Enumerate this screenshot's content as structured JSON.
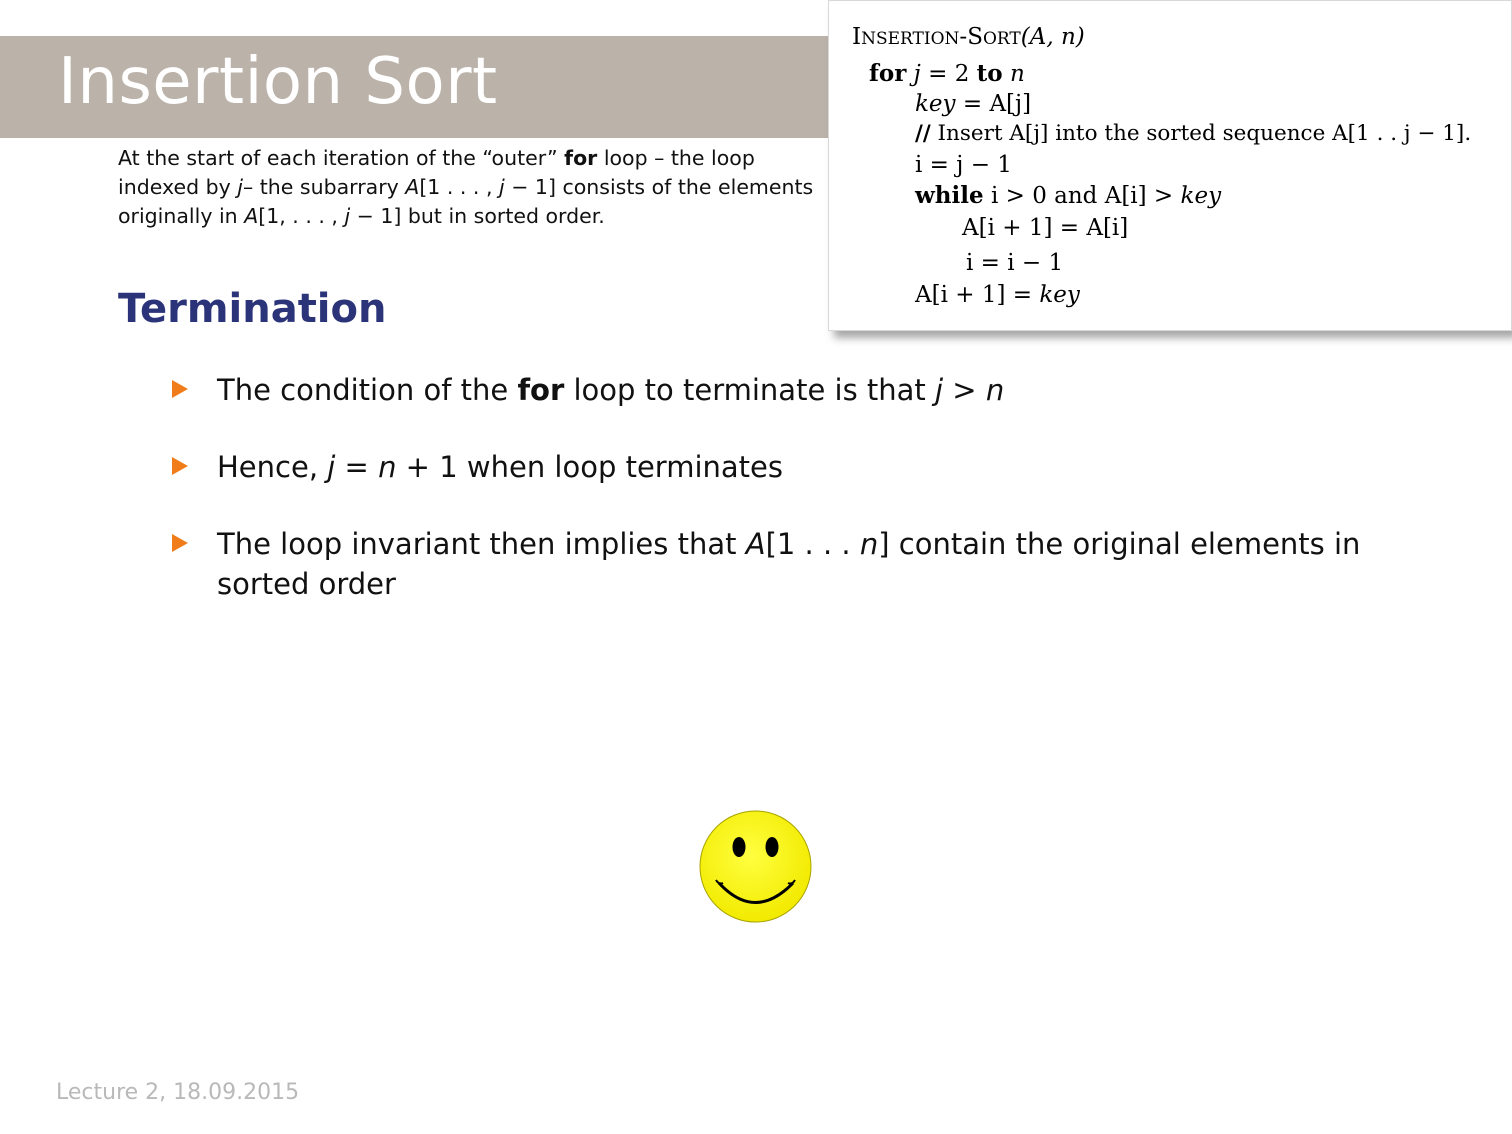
{
  "slide": {
    "title": "Insertion Sort",
    "section_heading": "Termination",
    "footer": "Lecture 2, 18.09.2015"
  },
  "invariant": {
    "t1": "At the start of each iteration of the “outer” ",
    "for_kw": "for",
    "t2": " loop – the loop indexed by ",
    "j": "j",
    "t3": "– the subarrary ",
    "A1": "A",
    "t4": "[1 . . . , ",
    "j2": "j",
    "t5": " − 1] consists of the elements originally in ",
    "A2": "A",
    "t6": "[1, . . . , ",
    "j3": "j",
    "t7": " − 1] but in sorted order."
  },
  "pseudocode": {
    "header_I": "I",
    "header_nsertion": "NSERTION",
    "header_dash": "-",
    "header_S": "S",
    "header_ort": "ORT",
    "header_params": "(A, n)",
    "l1_for": "for",
    "l1_j": "j",
    "l1_eq": " = 2 ",
    "l1_to": "to",
    "l1_n": "n",
    "l2_key": "key",
    "l2_rest": " = A[j]",
    "l3_slash": "//",
    "l3_rest": " Insert A[j] into the sorted sequence A[1 . . j − 1].",
    "l4": "i = j − 1",
    "l5_while": "while",
    "l5_rest": " i > 0 and A[i] > ",
    "l5_key": "key",
    "l6": "A[i + 1] = A[i]",
    "l7": "i = i − 1",
    "l8_rest": "A[i + 1] = ",
    "l8_key": "key"
  },
  "bullets": [
    {
      "a": "The condition of the ",
      "bold": "for",
      "b": " loop to terminate is that ",
      "m1": "j",
      "m2": " > ",
      "m3": "n"
    },
    {
      "a": "Hence, ",
      "m1": "j",
      "m2": " = ",
      "m3": "n",
      "m4": " + 1",
      "b": " when loop terminates"
    },
    {
      "a": "The loop invariant then implies that ",
      "m1": "A",
      "m2": "[1 . . . ",
      "m3": "n",
      "m4": "]",
      "b": " contain the original elements in sorted order"
    }
  ],
  "colors": {
    "title_bar": "#bbb3aa",
    "section_heading": "#2c3479",
    "bullet_marker": "#f07d1a",
    "smiley_face": "#f8f300"
  },
  "icons": {
    "bullet": "orange-triangle-bullet",
    "decoration": "smiley-face-icon"
  }
}
